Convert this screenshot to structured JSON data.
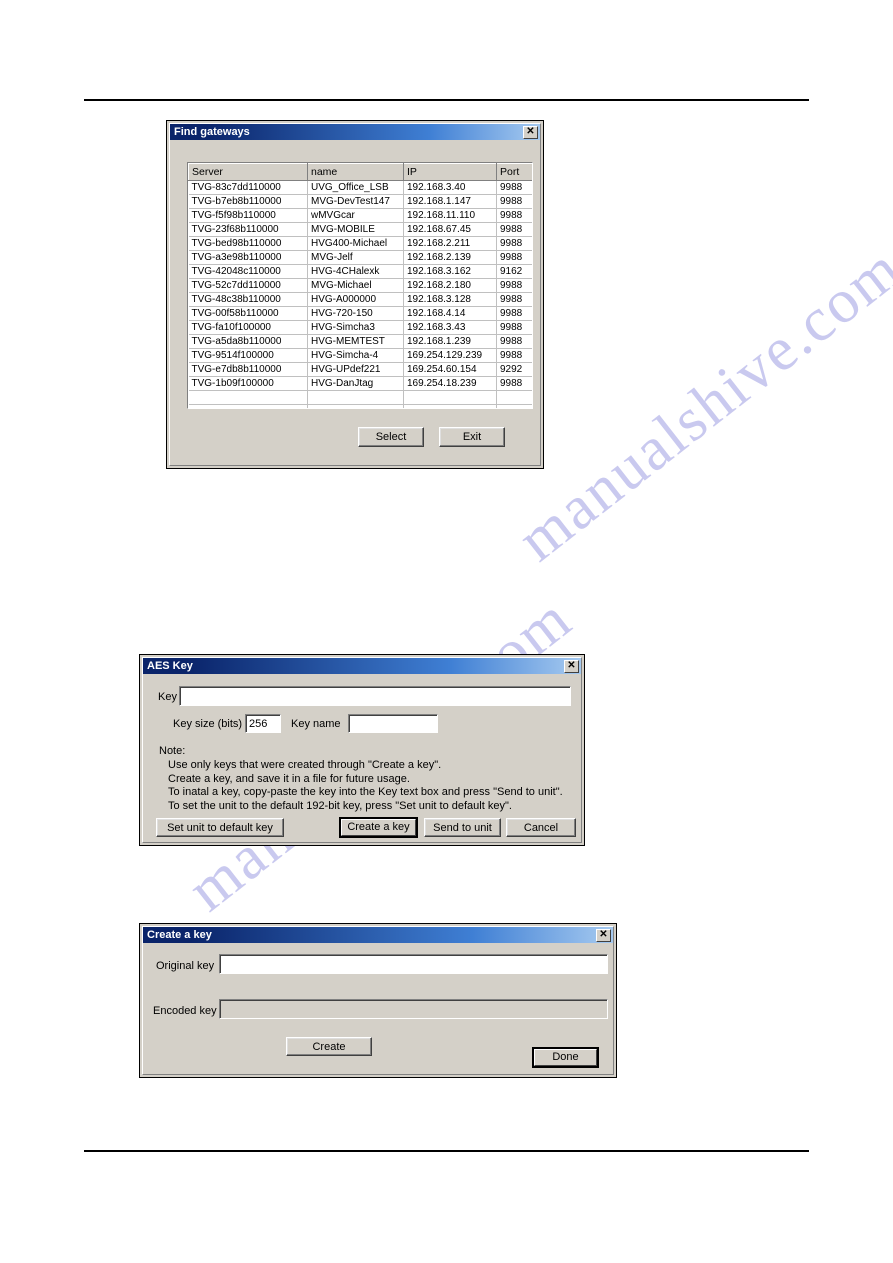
{
  "page": {
    "watermark_text": "manualshive.com"
  },
  "find_gateways": {
    "title": "Find gateways",
    "close_label": "✕",
    "columns": [
      "Server",
      "name",
      "IP",
      "Port"
    ],
    "rows": [
      [
        "TVG-83c7dd110000",
        "UVG_Office_LSB",
        "192.168.3.40",
        "9988"
      ],
      [
        "TVG-b7eb8b110000",
        "MVG-DevTest147",
        "192.168.1.147",
        "9988"
      ],
      [
        "TVG-f5f98b110000",
        "wMVGcar",
        "192.168.11.110",
        "9988"
      ],
      [
        "TVG-23f68b110000",
        "MVG-MOBILE",
        "192.168.67.45",
        "9988"
      ],
      [
        "TVG-bed98b110000",
        "HVG400-Michael",
        "192.168.2.211",
        "9988"
      ],
      [
        "TVG-a3e98b110000",
        "MVG-Jelf",
        "192.168.2.139",
        "9988"
      ],
      [
        "TVG-42048c110000",
        "HVG-4CHalexk",
        "192.168.3.162",
        "9162"
      ],
      [
        "TVG-52c7dd110000",
        "MVG-Michael",
        "192.168.2.180",
        "9988"
      ],
      [
        "TVG-48c38b110000",
        "HVG-A000000",
        "192.168.3.128",
        "9988"
      ],
      [
        "TVG-00f58b110000",
        "HVG-720-150",
        "192.168.4.14",
        "9988"
      ],
      [
        "TVG-fa10f100000",
        "HVG-Simcha3",
        "192.168.3.43",
        "9988"
      ],
      [
        "TVG-a5da8b110000",
        "HVG-MEMTEST",
        "192.168.1.239",
        "9988"
      ],
      [
        "TVG-9514f100000",
        "HVG-Simcha-4",
        "169.254.129.239",
        "9988"
      ],
      [
        "TVG-e7db8b110000",
        "HVG-UPdef221",
        "169.254.60.154",
        "9292"
      ],
      [
        "TVG-1b09f100000",
        "HVG-DanJtag",
        "169.254.18.239",
        "9988"
      ],
      [
        "",
        "",
        "",
        ""
      ],
      [
        "",
        "",
        "",
        ""
      ],
      [
        "",
        "",
        "",
        ""
      ]
    ],
    "select_button": "Select",
    "exit_button": "Exit"
  },
  "aes_key": {
    "title": "AES Key",
    "close_label": "✕",
    "key_label": "Key",
    "key_value": "",
    "key_size_label": "Key size (bits)",
    "key_size_value": "256",
    "key_name_label": "Key name",
    "key_name_value": "",
    "note_title": "Note:",
    "note_lines": [
      "Use only keys that were created through  \"Create a key\".",
      "Create a key, and save it in a file for future usage.",
      "To inatal a key, copy-paste the key into the Key text box and press \"Send to unit\".",
      "To set the unit to the default 192-bit key, press \"Set unit to default key\"."
    ],
    "set_default_button": "Set unit to default key",
    "create_key_button": "Create a key",
    "send_to_unit_button": "Send to unit",
    "cancel_button": "Cancel"
  },
  "create_a_key": {
    "title": "Create a key",
    "close_label": "✕",
    "original_key_label": "Original key",
    "original_key_value": "",
    "encoded_key_label": "Encoded key",
    "encoded_key_value": "",
    "create_button": "Create",
    "done_button": "Done"
  }
}
